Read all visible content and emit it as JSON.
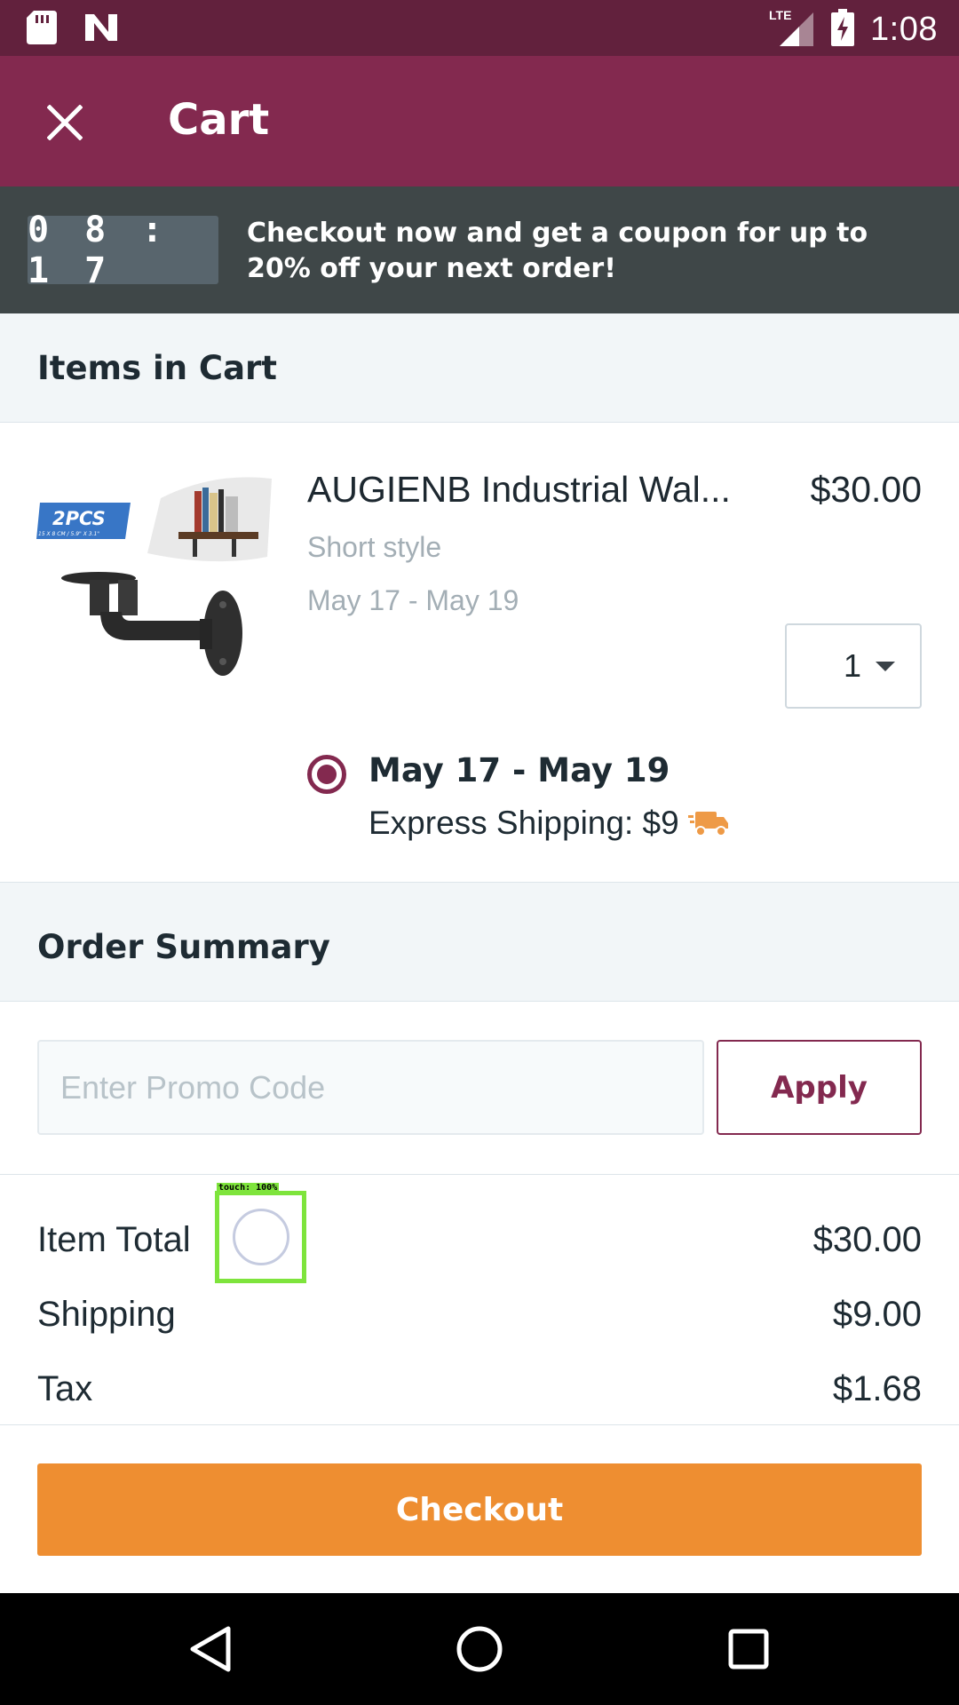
{
  "status_bar": {
    "time": "1:08",
    "network": "LTE",
    "icons": [
      "sd-card-icon",
      "n-notification-icon",
      "lte-signal-icon",
      "battery-charging-icon"
    ]
  },
  "app_bar": {
    "title": "Cart",
    "close_icon": "close-icon"
  },
  "promo_banner": {
    "timer": "08:17",
    "message": "Checkout now and get a coupon for up to 20% off your next order!"
  },
  "items_section": {
    "header": "Items in Cart",
    "items": [
      {
        "image_badge": "2PCS",
        "image_badge_sub": "15 X 8 CM / 5.9\" X 3.1\"",
        "name": "AUGIENB Industrial Wal...",
        "price": "$30.00",
        "variant": "Short style",
        "delivery_estimate": "May 17 - May 19",
        "quantity": "1",
        "shipping_option": {
          "selected": true,
          "dates": "May 17 - May 19",
          "method": "Express Shipping: $9",
          "icon": "delivery-truck-icon"
        }
      }
    ]
  },
  "order_summary": {
    "header": "Order Summary",
    "promo_placeholder": "Enter Promo Code",
    "promo_value": "",
    "apply_label": "Apply",
    "rows": [
      {
        "label": "Item Total",
        "value": "$30.00"
      },
      {
        "label": "Shipping",
        "value": "$9.00"
      },
      {
        "label": "Tax",
        "value": "$1.68"
      }
    ]
  },
  "touch_overlay": {
    "label": "touch: 100%"
  },
  "checkout": {
    "label": "Checkout"
  },
  "nav_bar": {
    "buttons": [
      "back-icon",
      "home-icon",
      "recents-icon"
    ]
  },
  "colors": {
    "status_bar": "#62213d",
    "app_bar": "#83294f",
    "banner": "#3f4748",
    "timer_bg": "#58656d",
    "accent": "#83294f",
    "checkout": "#ee8e31",
    "section_bg": "#f2f6f8",
    "muted_text": "#a3aeb5"
  }
}
